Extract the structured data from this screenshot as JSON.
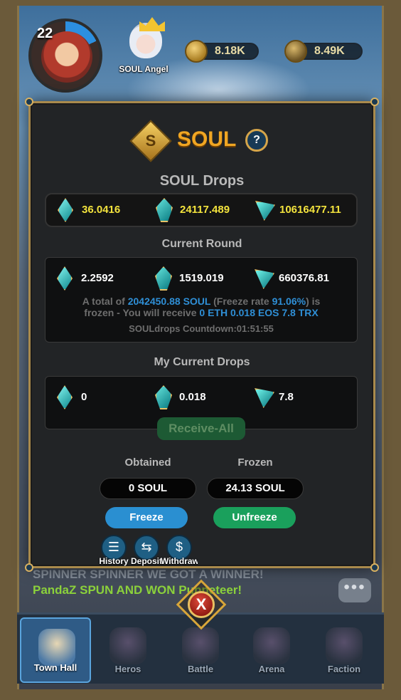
{
  "hud": {
    "level": "22",
    "hero_name": "SOUL Angel",
    "currency_gold": "8.18K",
    "currency_bag": "8.49K"
  },
  "ticker": {
    "line1": "SPINNER SPINNER WE GOT A WINNER!",
    "line2": "PandaZ SPUN AND WON Puppeteer!"
  },
  "modal": {
    "emblem_letter": "S",
    "title": "SOUL",
    "help_label": "?",
    "drops_heading": "SOUL Drops",
    "drops": [
      {
        "token": "ETH",
        "icon": "eth-gem-icon",
        "value": "36.0416"
      },
      {
        "token": "EOS",
        "icon": "eos-gem-icon",
        "value": "24117.489"
      },
      {
        "token": "TRX",
        "icon": "trx-gem-icon",
        "value": "10616477.11"
      }
    ],
    "round_heading": "Current Round",
    "round": [
      {
        "token": "ETH",
        "value": "2.2592"
      },
      {
        "token": "EOS",
        "value": "1519.019"
      },
      {
        "token": "TRX",
        "value": "660376.81"
      }
    ],
    "round_note": {
      "prefix": "A total of ",
      "soul_total": "2042450.88 SOUL",
      "freeze_open": " (Freeze rate ",
      "freeze_rate": "91.06%",
      "freeze_close": ") is",
      "line2_prefix": "frozen - You will receive ",
      "receive": "0 ETH 0.018 EOS 7.8 TRX"
    },
    "countdown": "SOULdrops Countdown:01:51:55",
    "mine_heading": "My Current Drops",
    "mine": [
      {
        "token": "ETH",
        "value": "0"
      },
      {
        "token": "EOS",
        "value": "0.018"
      },
      {
        "token": "TRX",
        "value": "7.8"
      }
    ],
    "receive_all": "Receive-All",
    "obtained_label": "Obtained",
    "obtained_value": "0 SOUL",
    "frozen_label": "Frozen",
    "frozen_value": "24.13 SOUL",
    "freeze_btn": "Freeze",
    "unfreeze_btn": "Unfreeze",
    "mini_buttons": [
      {
        "label": "History",
        "icon": "history-icon"
      },
      {
        "label": "Deposit",
        "icon": "deposit-icon"
      },
      {
        "label": "Withdraw",
        "icon": "withdraw-icon"
      }
    ]
  },
  "close_label": "X",
  "nav": [
    {
      "label": "Town Hall",
      "active": true
    },
    {
      "label": "Heros",
      "active": false
    },
    {
      "label": "Battle",
      "active": false
    },
    {
      "label": "Arena",
      "active": false
    },
    {
      "label": "Faction",
      "active": false
    }
  ],
  "colors": {
    "accent_gold": "#f0a623",
    "value_yellow": "#f3e33d",
    "link_blue": "#2f8fd6",
    "freeze_blue": "#2a8fd1",
    "unfreeze_green": "#1aa05c"
  }
}
